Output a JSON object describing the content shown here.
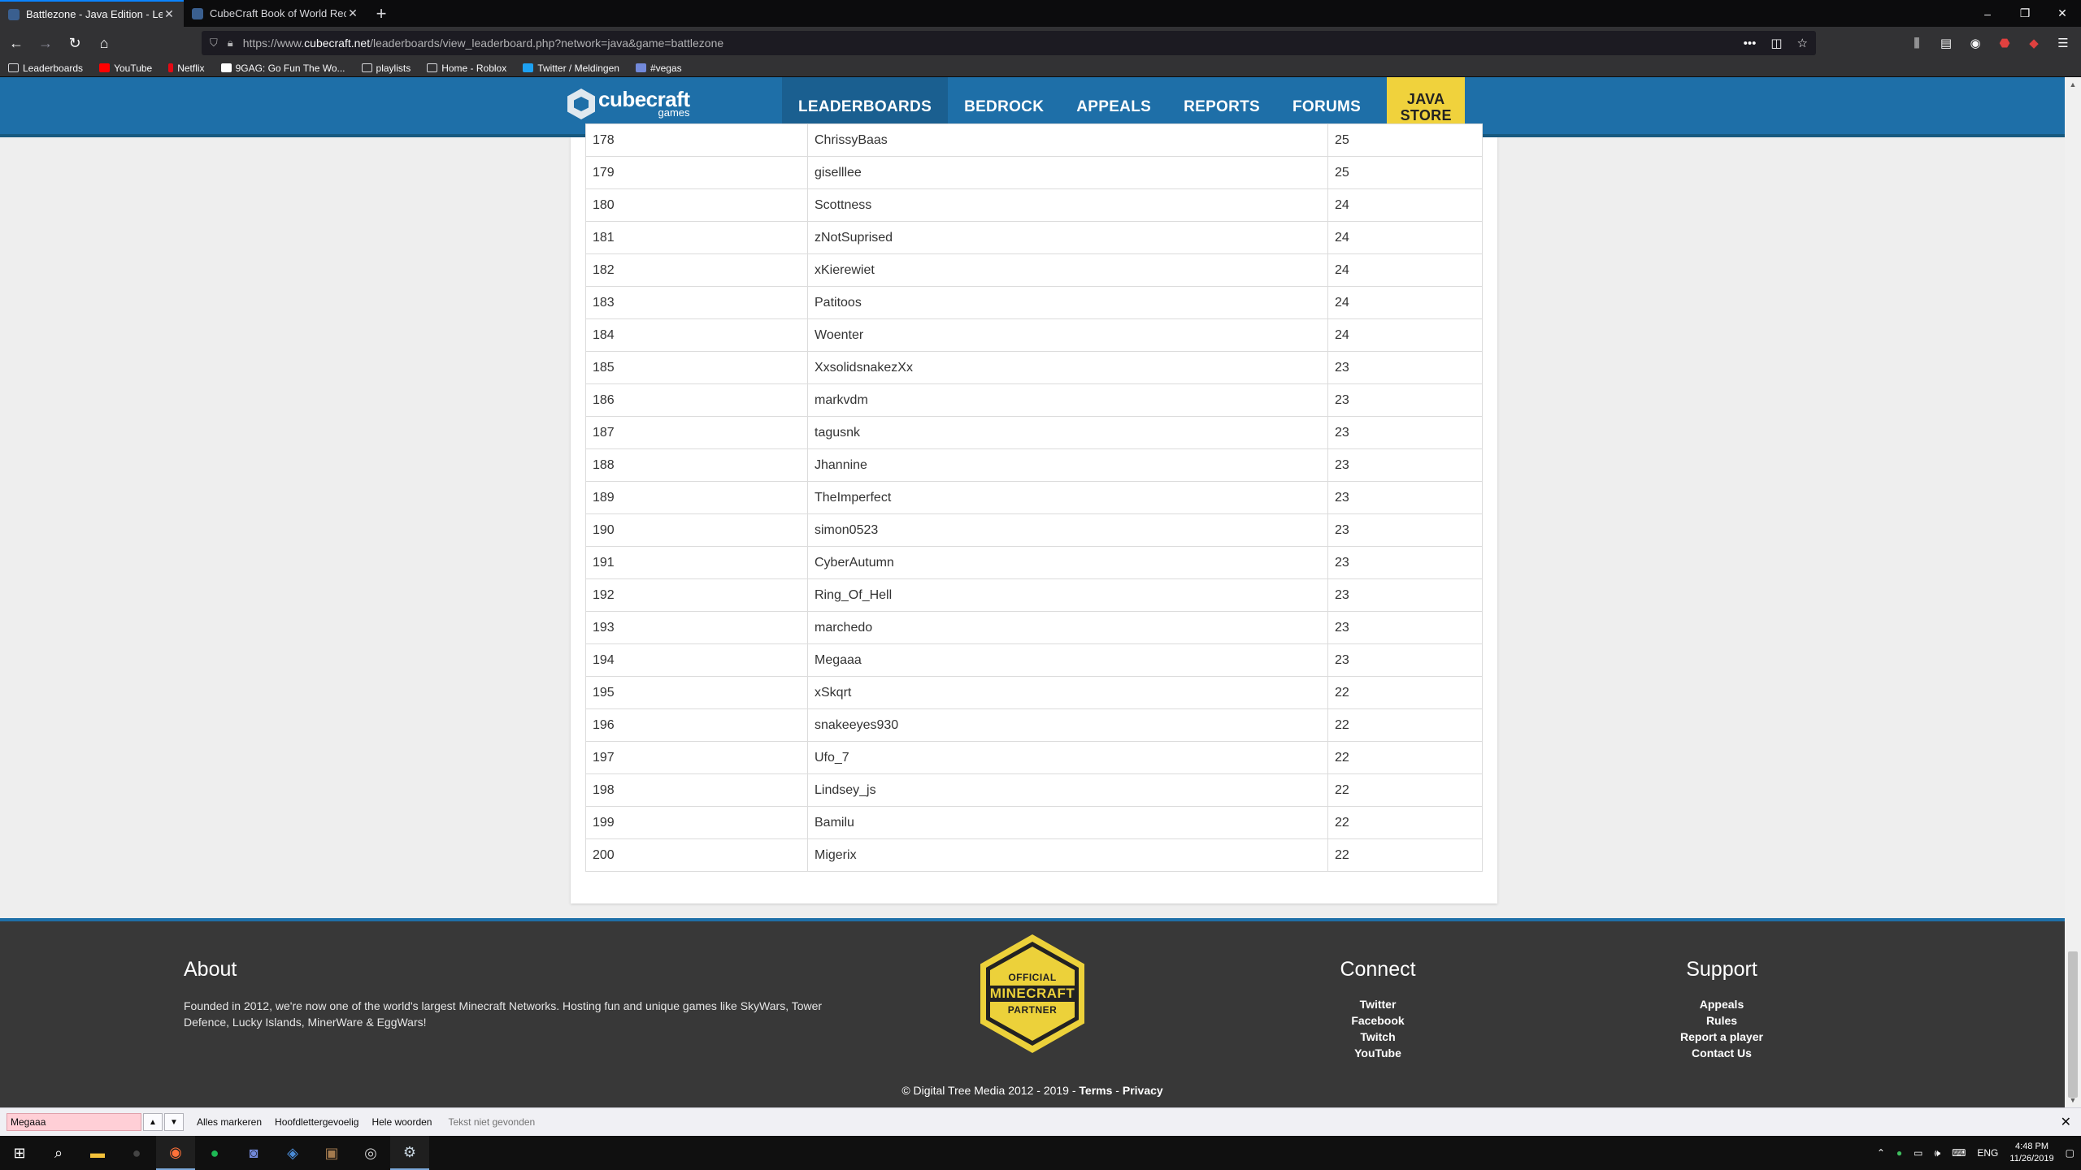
{
  "browser": {
    "tabs": [
      {
        "title": "Battlezone - Java Edition - Lead",
        "active": true
      },
      {
        "title": "CubeCraft Book of World Reco",
        "active": false
      }
    ],
    "new_tab": "+",
    "url_prefix": "https://www.",
    "url_domain": "cubecraft.net",
    "url_path": "/leaderboards/view_leaderboard.php?network=java&game=battlezone",
    "bookmarks": [
      "Leaderboards",
      "YouTube",
      "Netflix",
      "9GAG: Go Fun The Wo...",
      "playlists",
      "Home - Roblox",
      "Twitter / Meldingen",
      "#vegas"
    ]
  },
  "site": {
    "logo_word": "cubecraft",
    "logo_sub": "games",
    "nav": [
      "LEADERBOARDS",
      "BEDROCK",
      "APPEALS",
      "REPORTS",
      "FORUMS"
    ],
    "store_line1": "JAVA",
    "store_line2": "STORE"
  },
  "leaderboard": {
    "rows": [
      {
        "rank": "178",
        "name": "ChrissyBaas",
        "score": "25"
      },
      {
        "rank": "179",
        "name": "giselllee",
        "score": "25"
      },
      {
        "rank": "180",
        "name": "Scottness",
        "score": "24"
      },
      {
        "rank": "181",
        "name": "zNotSuprised",
        "score": "24"
      },
      {
        "rank": "182",
        "name": "xKierewiet",
        "score": "24"
      },
      {
        "rank": "183",
        "name": "Patitoos",
        "score": "24"
      },
      {
        "rank": "184",
        "name": "Woenter",
        "score": "24"
      },
      {
        "rank": "185",
        "name": "XxsolidsnakezXx",
        "score": "23"
      },
      {
        "rank": "186",
        "name": "markvdm",
        "score": "23"
      },
      {
        "rank": "187",
        "name": "tagusnk",
        "score": "23"
      },
      {
        "rank": "188",
        "name": "Jhannine",
        "score": "23"
      },
      {
        "rank": "189",
        "name": "TheImperfect",
        "score": "23"
      },
      {
        "rank": "190",
        "name": "simon0523",
        "score": "23"
      },
      {
        "rank": "191",
        "name": "CyberAutumn",
        "score": "23"
      },
      {
        "rank": "192",
        "name": "Ring_Of_Hell",
        "score": "23"
      },
      {
        "rank": "193",
        "name": "marchedo",
        "score": "23"
      },
      {
        "rank": "194",
        "name": "Megaaa",
        "score": "23"
      },
      {
        "rank": "195",
        "name": "xSkqrt",
        "score": "22"
      },
      {
        "rank": "196",
        "name": "snakeeyes930",
        "score": "22"
      },
      {
        "rank": "197",
        "name": "Ufo_7",
        "score": "22"
      },
      {
        "rank": "198",
        "name": "Lindsey_js",
        "score": "22"
      },
      {
        "rank": "199",
        "name": "Bamilu",
        "score": "22"
      },
      {
        "rank": "200",
        "name": "Migerix",
        "score": "22"
      }
    ]
  },
  "footer": {
    "about_title": "About",
    "about_text": "Founded in 2012, we're now one of the world's largest Minecraft Networks. Hosting fun and unique games like SkyWars, Tower Defence, Lucky Islands, MinerWare & EggWars!",
    "badge_top": "OFFICIAL",
    "badge_mid": "MINECRAFT",
    "badge_bottom": "PARTNER",
    "connect_title": "Connect",
    "connect_links": [
      "Twitter",
      "Facebook",
      "Twitch",
      "YouTube"
    ],
    "support_title": "Support",
    "support_links": [
      "Appeals",
      "Rules",
      "Report a player",
      "Contact Us"
    ],
    "copyright": "© Digital Tree Media 2012 - 2019 -",
    "terms": "Terms",
    "privacy": "Privacy",
    "separator": "-"
  },
  "findbar": {
    "value": "Megaaa",
    "highlight_all": "Alles markeren",
    "match_case": "Hoofdlettergevoelig",
    "whole_words": "Hele woorden",
    "status": "Tekst niet gevonden"
  },
  "taskbar": {
    "language": "ENG",
    "time": "4:48 PM",
    "date": "11/26/2019"
  },
  "colors": {
    "header_blue": "#1e6fa8",
    "store_yellow": "#f0d23c",
    "footer_bg": "#383838"
  }
}
